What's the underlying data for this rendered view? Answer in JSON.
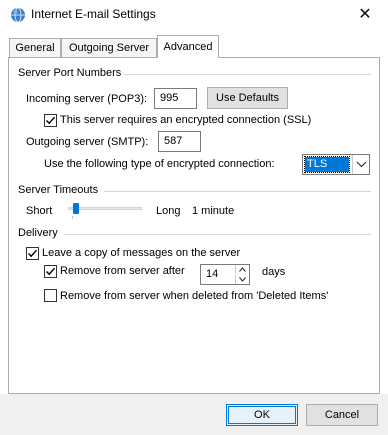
{
  "window": {
    "title": "Internet E-mail Settings",
    "close_glyph": "✕"
  },
  "tabs": [
    {
      "label": "General"
    },
    {
      "label": "Outgoing Server"
    },
    {
      "label": "Advanced"
    }
  ],
  "server_ports": {
    "group_label": "Server Port Numbers",
    "incoming_label": "Incoming server (POP3):",
    "incoming_value": "995",
    "use_defaults_label": "Use Defaults",
    "ssl_label": "This server requires an encrypted connection (SSL)",
    "ssl_checked": true,
    "outgoing_label": "Outgoing server (SMTP):",
    "outgoing_value": "587",
    "encryption_label": "Use the following type of encrypted connection:",
    "encryption_value": "TLS"
  },
  "timeouts": {
    "group_label": "Server Timeouts",
    "short_label": "Short",
    "long_label": "Long",
    "value_text": "1 minute",
    "slider_level": 0.05
  },
  "delivery": {
    "group_label": "Delivery",
    "leave_copy_label": "Leave a copy of messages on the server",
    "leave_copy_checked": true,
    "remove_after_label": "Remove from server after",
    "remove_after_checked": true,
    "days_value": "14",
    "days_label": "days",
    "remove_deleted_label": "Remove from server when deleted from 'Deleted Items'",
    "remove_deleted_checked": false
  },
  "buttons": {
    "ok_label": "OK",
    "cancel_label": "Cancel"
  },
  "colors": {
    "accent": "#0078d7",
    "border": "#adadad",
    "footer": "#f0f0f0"
  }
}
